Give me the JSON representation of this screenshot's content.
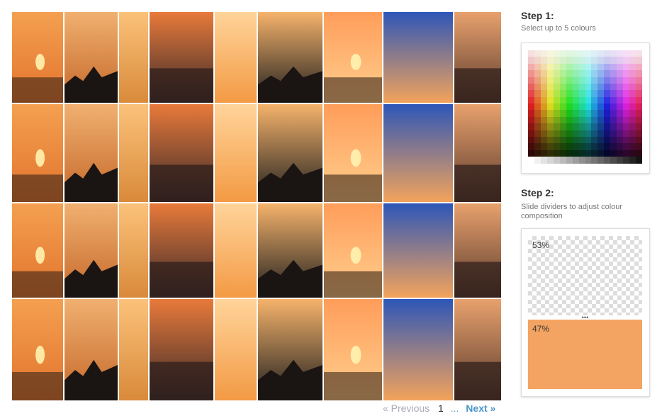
{
  "step1": {
    "title": "Step 1:",
    "subtitle": "Select up to 5 colours"
  },
  "step2": {
    "title": "Step 2:",
    "subtitle": "Slide dividers to adjust colour composition"
  },
  "composition": [
    {
      "label": "53%",
      "color": "transparent"
    },
    {
      "label": "47%",
      "color": "#f4a462"
    }
  ],
  "pagination": {
    "previous": "« Previous",
    "current": "1",
    "ellipsis": "...",
    "next": "Next »"
  },
  "photo_tiles": [
    {
      "alt": "photo"
    },
    {
      "alt": "photo"
    },
    {
      "alt": "photo"
    },
    {
      "alt": "photo"
    },
    {
      "alt": "photo"
    },
    {
      "alt": "photo"
    },
    {
      "alt": "photo"
    },
    {
      "alt": "photo"
    },
    {
      "alt": "photo"
    },
    {
      "alt": "photo"
    }
  ],
  "colors": {
    "accent": "#4a97c8",
    "selected_swatch": "#f4a462"
  }
}
